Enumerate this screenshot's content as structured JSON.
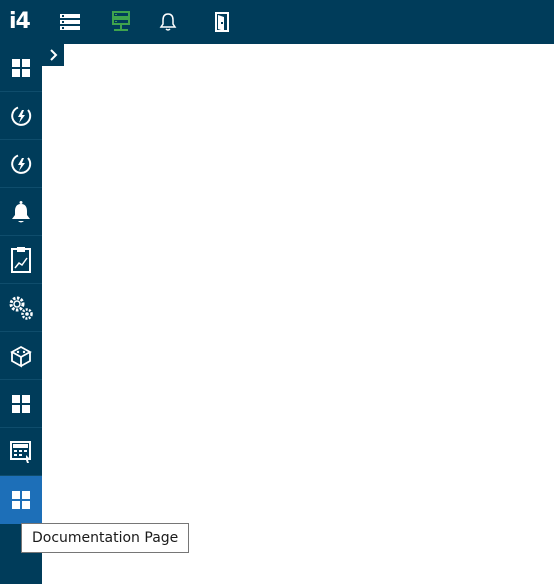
{
  "app": {
    "logo_text": "i4"
  },
  "topbar": {
    "icons": [
      "server-list-icon",
      "server-status-icon",
      "notification-bell-icon",
      "logout-door-icon"
    ]
  },
  "sidebar": {
    "items": [
      {
        "icon": "dashboard-grid-icon"
      },
      {
        "icon": "energy-bolt-icon"
      },
      {
        "icon": "energy-bolt-icon"
      },
      {
        "icon": "alarm-bell-icon"
      },
      {
        "icon": "clipboard-chart-icon"
      },
      {
        "icon": "settings-gears-icon"
      },
      {
        "icon": "modules-cube-icon"
      },
      {
        "icon": "dashboard-grid-icon"
      },
      {
        "icon": "calculator-monitor-icon"
      },
      {
        "icon": "dashboard-grid-icon",
        "active": true
      }
    ],
    "tooltip": "Documentation Page"
  },
  "colors": {
    "nav_bg": "#003c5a",
    "active_bg": "#1d6fb8",
    "server_green": "#3fa34d",
    "tooltip_border": "#767676"
  }
}
